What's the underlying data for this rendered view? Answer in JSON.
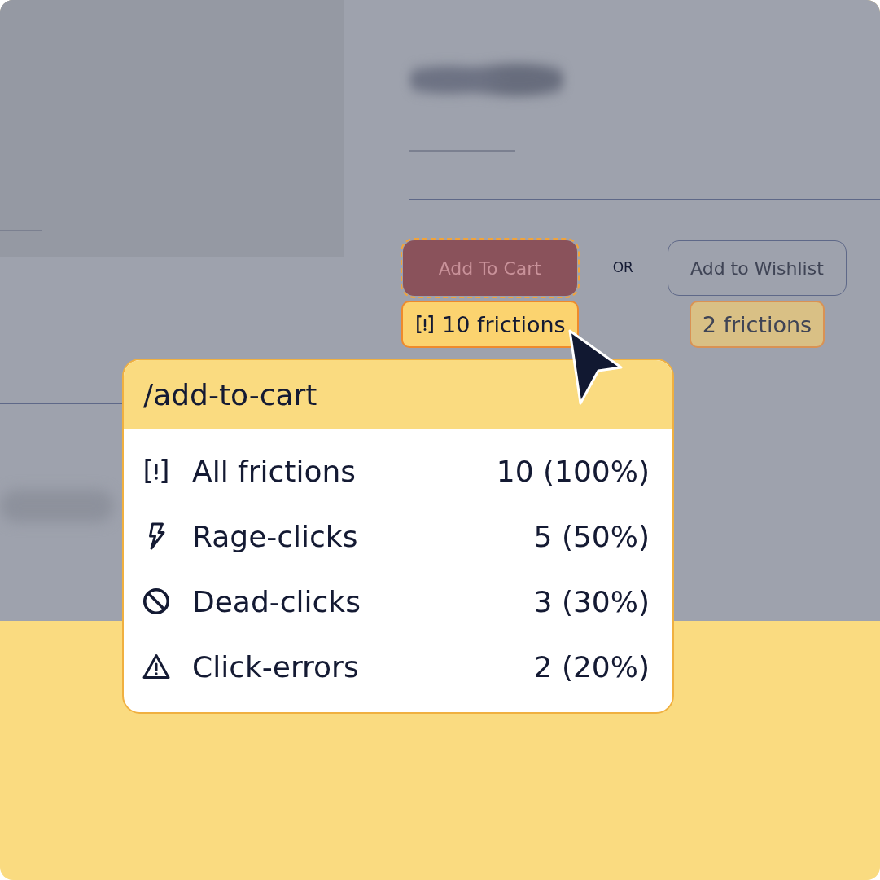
{
  "buttons": [
    {
      "label": "Add To Cart",
      "kind": "primary",
      "highlighted": true,
      "frictions": {
        "label": "10 frictions",
        "icon": true
      }
    },
    {
      "label": "Add to Wishlist",
      "kind": "outline",
      "highlighted": false,
      "frictions": {
        "label": "2 frictions",
        "icon": false
      }
    }
  ],
  "separator": "OR",
  "tooltip": {
    "title": "/add-to-cart",
    "rows": [
      {
        "kind": "all",
        "label": "All frictions",
        "value": "10 (100%)"
      },
      {
        "kind": "rage",
        "label": "Rage-clicks",
        "value": "5 (50%)"
      },
      {
        "kind": "dead",
        "label": "Dead-clicks",
        "value": "3 (30%)"
      },
      {
        "kind": "error",
        "label": "Click-errors",
        "value": "2 (20%)"
      }
    ]
  }
}
